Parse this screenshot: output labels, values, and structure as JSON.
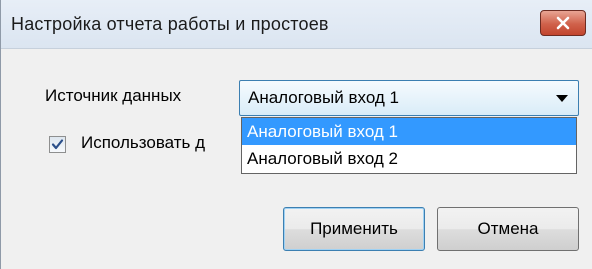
{
  "window": {
    "title": "Настройка отчета работы и простоев"
  },
  "data_source": {
    "label": "Источник данных",
    "selected_value": "Аналоговый вход 1",
    "options": [
      "Аналоговый вход 1",
      "Аналоговый вход 2"
    ]
  },
  "use_checkbox": {
    "label": "Использовать д",
    "checked": true
  },
  "buttons": {
    "apply": "Применить",
    "cancel": "Отмена"
  },
  "colors": {
    "selection": "#3399ff",
    "close_button": "#c2452e",
    "focus_border": "#3c7fb1"
  },
  "icons": {
    "close": "close-icon",
    "dropdown": "chevron-down-icon",
    "check": "check-icon"
  }
}
